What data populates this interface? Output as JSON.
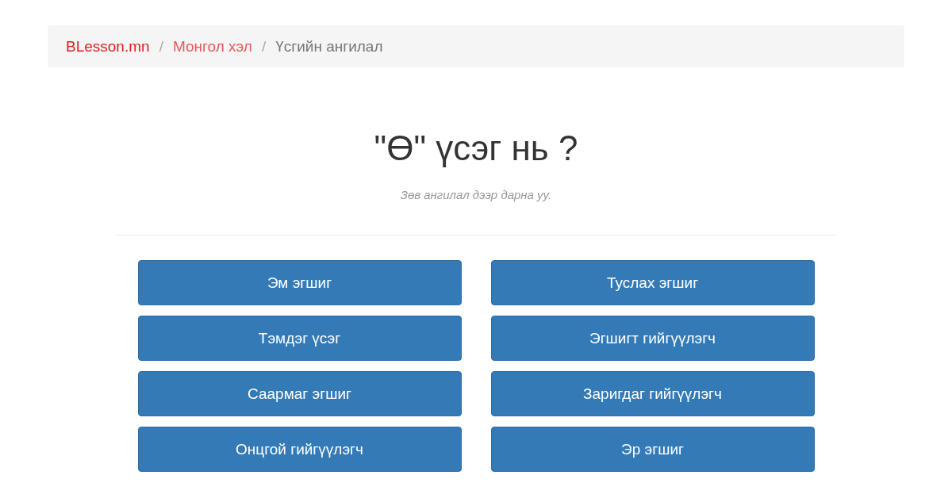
{
  "breadcrumb": [
    {
      "label": "BLesson.mn",
      "kind": "brand"
    },
    {
      "label": "Монгол хэл",
      "kind": "link"
    },
    {
      "label": "Үсгийн ангилал",
      "kind": "current"
    }
  ],
  "separator": "/",
  "question": {
    "title": "\"Ө\" үсэг нь ?",
    "hint": "Зөв ангилал дээр дарна уу."
  },
  "answers": [
    "Эм эгшиг",
    "Туслах эгшиг",
    "Тэмдэг үсэг",
    "Эгшигт гийгүүлэгч",
    "Саармаг эгшиг",
    "Заригдаг гийгүүлэгч",
    "Онцгой гийгүүлэгч",
    "Эр эгшиг"
  ]
}
